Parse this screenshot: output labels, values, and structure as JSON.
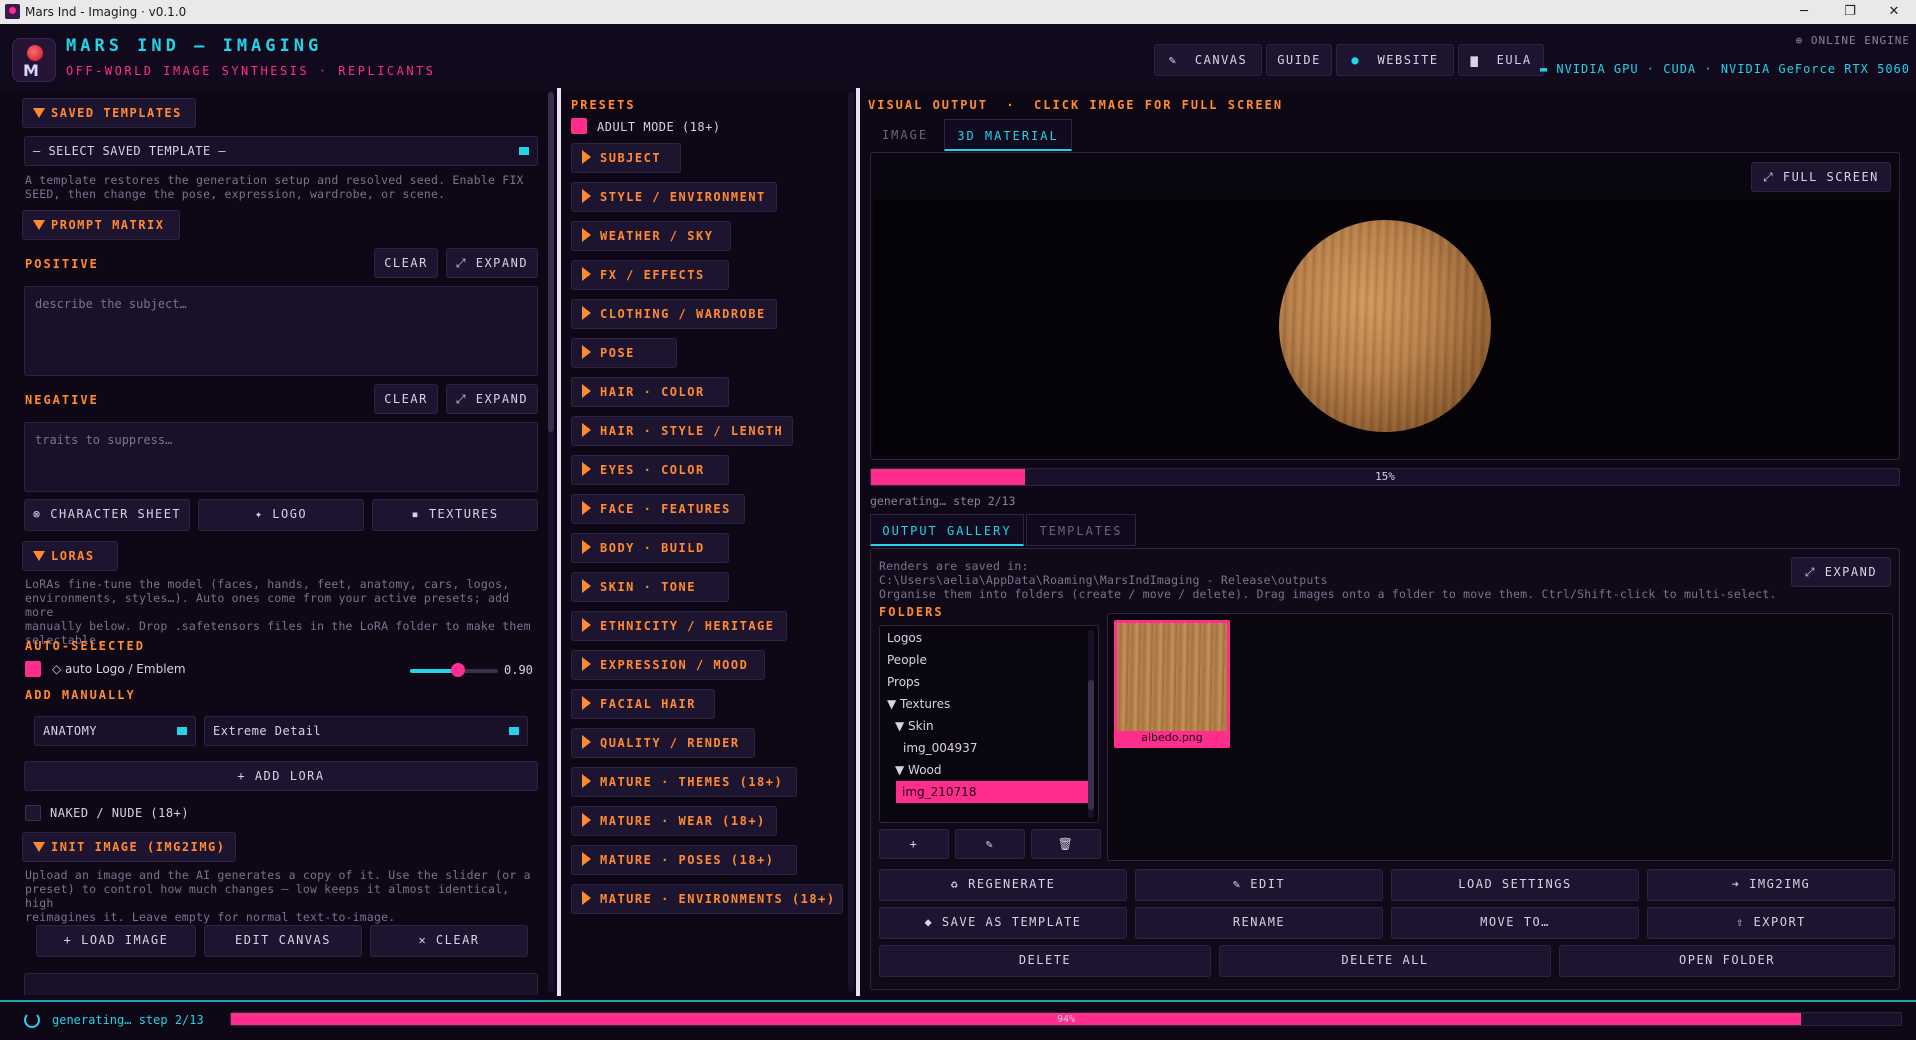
{
  "window": {
    "title": "Mars Ind - Imaging · v0.1.0",
    "controls": {
      "minimize": "─",
      "restore": "❐",
      "close": "✕"
    }
  },
  "brand": {
    "title": "MARS IND — IMAGING",
    "subtitle": "OFF-WORLD IMAGE SYNTHESIS · REPLICANTS",
    "logo_letter": "M"
  },
  "header": {
    "buttons": {
      "canvas": {
        "icon": "✎",
        "label": "CANVAS"
      },
      "guide": {
        "label": "GUIDE"
      },
      "website": {
        "icon": "●",
        "label": "WEBSITE"
      },
      "eula": {
        "icon": "▆",
        "label": "EULA"
      }
    },
    "online": "⊕ ONLINE ENGINE",
    "gpu": "▬ NVIDIA GPU · CUDA · NVIDIA GeForce RTX 5060"
  },
  "left": {
    "saved_templates": {
      "title": "SAVED TEMPLATES",
      "select": "— SELECT SAVED TEMPLATE —",
      "help_1": "A template restores the generation setup and resolved seed. Enable FIX",
      "help_2": "SEED, then change the pose, expression, wardrobe, or scene."
    },
    "prompt_matrix": {
      "title": "PROMPT MATRIX",
      "positive": "POSITIVE",
      "negative": "NEGATIVE",
      "clear": "CLEAR",
      "expand": "⤢ EXPAND",
      "positive_placeholder": "describe the subject…",
      "negative_placeholder": "traits to suppress…"
    },
    "tools": {
      "character_sheet": "⊗ CHARACTER SHEET",
      "logo": "✦ LOGO",
      "textures": "▪ TEXTURES"
    },
    "loras": {
      "title": "LORAS",
      "help_1": "LoRAs fine-tune the model (faces, hands, feet, anatomy, cars, logos,",
      "help_2": "environments, styles…). Auto ones come from your active presets; add more",
      "help_3": "manually below. Drop .safetensors files in the LoRA folder to make them",
      "help_4": "selectable.",
      "auto_selected": "AUTO-SELECTED",
      "auto_item": "◇ auto Logo / Emblem",
      "auto_value": "0.90",
      "auto_weight_fraction": 0.55,
      "add_manually": "ADD MANUALLY",
      "category": "ANATOMY",
      "lora_name": "Extreme Detail",
      "add_lora": "+ ADD LORA",
      "nude": "NAKED / NUDE (18+)"
    },
    "init_image": {
      "title": "INIT IMAGE (IMG2IMG)",
      "help_1": "Upload an image and the AI generates a copy of it. Use the slider (or a",
      "help_2": "preset) to control how much changes — low keeps it almost identical, high",
      "help_3": "reimagines it. Leave empty for normal text-to-image.",
      "load": "+ LOAD IMAGE",
      "edit": "EDIT CANVAS",
      "clear": "✕ CLEAR"
    }
  },
  "presets": {
    "title": "PRESETS",
    "adult_mode": "ADULT MODE (18+)",
    "items": [
      "SUBJECT",
      "STYLE / ENVIRONMENT",
      "WEATHER / SKY",
      "FX / EFFECTS",
      "CLOTHING / WARDROBE",
      "POSE",
      "HAIR · COLOR",
      "HAIR · STYLE / LENGTH",
      "EYES · COLOR",
      "FACE · FEATURES",
      "BODY · BUILD",
      "SKIN · TONE",
      "ETHNICITY / HERITAGE",
      "EXPRESSION / MOOD",
      "FACIAL HAIR",
      "QUALITY / RENDER",
      "MATURE · THEMES (18+)",
      "MATURE · WEAR (18+)",
      "MATURE · POSES (18+)",
      "MATURE · ENVIRONMENTS (18+)"
    ]
  },
  "output": {
    "title": "VISUAL OUTPUT  ·  CLICK IMAGE FOR FULL SCREEN",
    "tabs": {
      "image": "IMAGE",
      "material": "3D MATERIAL"
    },
    "fullscreen": "⤢ FULL SCREEN",
    "progress": 0.15,
    "progress_label": "15%",
    "status": "generating… step 2/13",
    "gallery_tabs": {
      "gallery": "OUTPUT GALLERY",
      "templates": "TEMPLATES"
    },
    "saved_in": "Renders are saved in:",
    "path": "C:\\Users\\aelia\\AppData\\Roaming\\MarsIndImaging - Release\\outputs",
    "organise": "Organise them into folders (create / move / delete). Drag images onto a folder to move them. Ctrl/Shift-click to multi-select.",
    "expand": "⤢ EXPAND",
    "folders_label": "FOLDERS",
    "folders": {
      "logos": "Logos",
      "people": "People",
      "props": "Props",
      "textures": "▼ Textures",
      "skin": "▼ Skin",
      "img1": "img_004937",
      "wood": "▼ Wood",
      "img2": "img_210718"
    },
    "folder_actions": {
      "add": "+",
      "edit": "✎",
      "delete": "🗑"
    },
    "thumb_label": "albedo.png",
    "actions": {
      "regenerate": "♻ REGENERATE",
      "edit": "✎ EDIT",
      "load_settings": "LOAD SETTINGS",
      "img2img": "➔ IMG2IMG",
      "save_template": "◆ SAVE AS TEMPLATE",
      "rename": "RENAME",
      "move": "MOVE TO…",
      "export": "⇪ EXPORT",
      "delete": "DELETE",
      "delete_all": "DELETE ALL",
      "open_folder": "OPEN FOLDER"
    }
  },
  "footer": {
    "status": "generating… step 2/13",
    "progress": 0.94,
    "progress_label": "94%"
  },
  "colors": {
    "accent_pink": "#ff2d8b",
    "accent_cyan": "#23d3e8",
    "accent_orange": "#ff8a30",
    "background": "#0d0716"
  }
}
